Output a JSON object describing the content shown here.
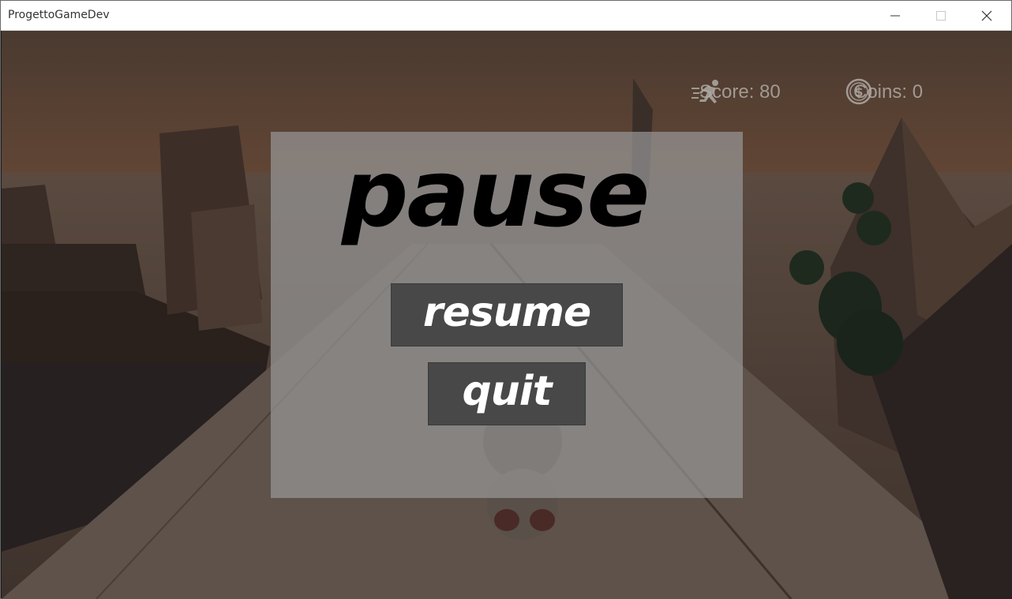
{
  "window": {
    "title": "ProgettoGameDev",
    "controls": [
      "minimize-icon",
      "maximize-icon",
      "close-icon"
    ]
  },
  "hud": {
    "score_label": "Score: 80",
    "coins_label": "Coins: 0",
    "score_icon": "runner-icon",
    "coins_icon": "dollar-coin-icon"
  },
  "pause_menu": {
    "title": "pause",
    "resume_label": "resume",
    "quit_label": "quit"
  },
  "colors": {
    "panel": "#969696",
    "button": "#484848",
    "title_text": "#000000",
    "button_text": "#ffffff"
  }
}
